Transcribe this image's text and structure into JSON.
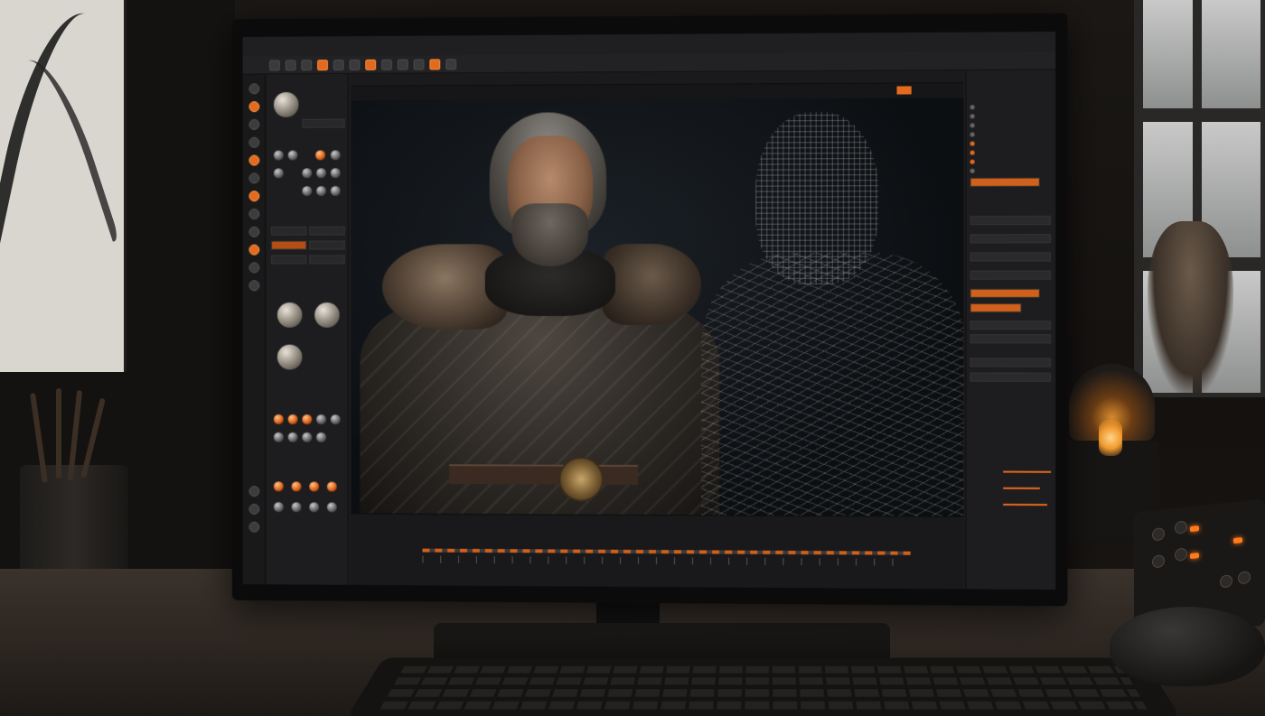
{
  "scene": {
    "accent_color": "#e36a1e",
    "description_items": [
      "wall-poster",
      "pencil-cup",
      "window",
      "statue",
      "desk-lamp",
      "audio-controller",
      "keyboard",
      "mouse"
    ]
  },
  "app": {
    "menubar": [
      "",
      "",
      "",
      "",
      "",
      "",
      "",
      ""
    ],
    "left_panel": {
      "title": "",
      "materials_section": "",
      "spheres_section": ""
    },
    "viewport": {
      "title": "",
      "center_label": "",
      "tabs": [
        "",
        ""
      ]
    },
    "right_panel": {
      "sections": [
        "",
        "",
        "",
        ""
      ]
    },
    "timeline": {
      "label": "",
      "sub_label": ""
    }
  }
}
